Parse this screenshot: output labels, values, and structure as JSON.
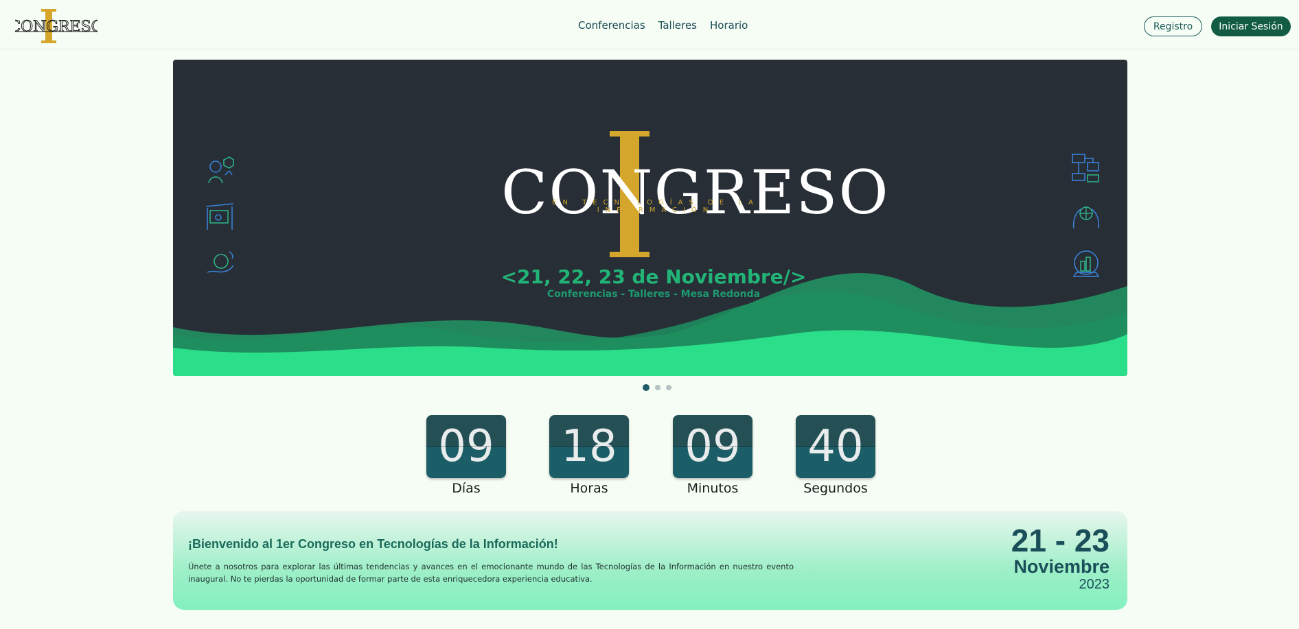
{
  "navbar": {
    "brand": {
      "logo_letter": "I",
      "logo_word": "CONGRESO"
    },
    "links": [
      {
        "label": "Conferencias"
      },
      {
        "label": "Talleres"
      },
      {
        "label": "Horario"
      }
    ],
    "register_label": "Registro",
    "login_label": "Iniciar Sesión"
  },
  "hero": {
    "logo_letter": "I",
    "title": "CONGRESO",
    "subtitle": "EN TECNOLOGÍAS DE LA INFORMACIÓN",
    "dates": "<21, 22, 23 de Noviembre/>",
    "tagline": "Conferencias - Talleres - Mesa Redonda",
    "icons_left": [
      "person-cube-icon",
      "classroom-screen-icon",
      "hand-network-icon"
    ],
    "icons_right": [
      "flowchart-icon",
      "hands-globe-icon",
      "globe-city-icon"
    ],
    "colors": {
      "background": "#272e36",
      "gold": "#d4a72c",
      "wave_light": "#2ade8a",
      "wave_dark": "#23a56c"
    }
  },
  "carousel": {
    "slides": 3,
    "active_index": 0
  },
  "countdown": [
    {
      "value": "09",
      "label": "Días"
    },
    {
      "value": "18",
      "label": "Horas"
    },
    {
      "value": "09",
      "label": "Minutos"
    },
    {
      "value": "40",
      "label": "Segundos"
    }
  ],
  "welcome": {
    "title": "¡Bienvenido al 1er Congreso en Tecnologías de la Información!",
    "text": "Únete a nosotros para explorar las últimas tendencias y avances en el emocionante mundo de las Tecnologías de la Información en nuestro evento inaugural. No te pierdas la oportunidad de formar parte de esta enriquecedora experiencia educativa.",
    "date_range": "21 - 23",
    "month": "Noviembre",
    "year": "2023"
  }
}
